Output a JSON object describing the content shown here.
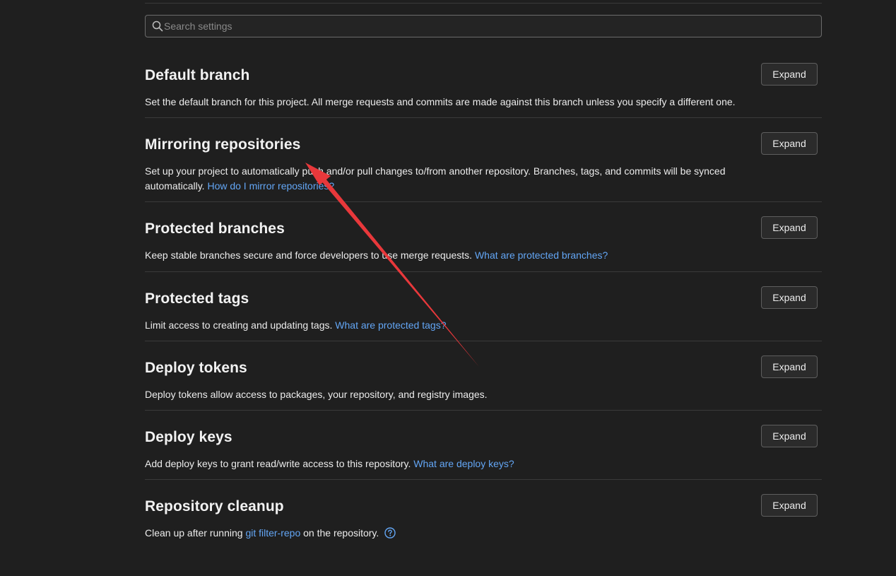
{
  "search": {
    "placeholder": "Search settings"
  },
  "sections": [
    {
      "title": "Default branch",
      "desc": "Set the default branch for this project. All merge requests and commits are made against this branch unless you specify a different one.",
      "button": "Expand"
    },
    {
      "title": "Mirroring repositories",
      "desc": "Set up your project to automatically push and/or pull changes to/from another repository. Branches, tags, and commits will be synced automatically.",
      "link": "How do I mirror repositories?",
      "button": "Expand"
    },
    {
      "title": "Protected branches",
      "desc": "Keep stable branches secure and force developers to use merge requests.",
      "link": "What are protected branches?",
      "button": "Expand"
    },
    {
      "title": "Protected tags",
      "desc": "Limit access to creating and updating tags.",
      "link": "What are protected tags?",
      "button": "Expand"
    },
    {
      "title": "Deploy tokens",
      "desc": "Deploy tokens allow access to packages, your repository, and registry images.",
      "button": "Expand"
    },
    {
      "title": "Deploy keys",
      "desc": "Add deploy keys to grant read/write access to this repository.",
      "link": "What are deploy keys?",
      "button": "Expand"
    },
    {
      "title": "Repository cleanup",
      "desc_before": "Clean up after running",
      "link": "git filter-repo",
      "desc_after": "on the repository.",
      "button": "Expand"
    }
  ],
  "colors": {
    "background": "#1f1f1f",
    "link": "#63a6f5",
    "annotation_arrow": "#e8383b"
  },
  "icons": [
    "search-icon",
    "help-icon"
  ]
}
